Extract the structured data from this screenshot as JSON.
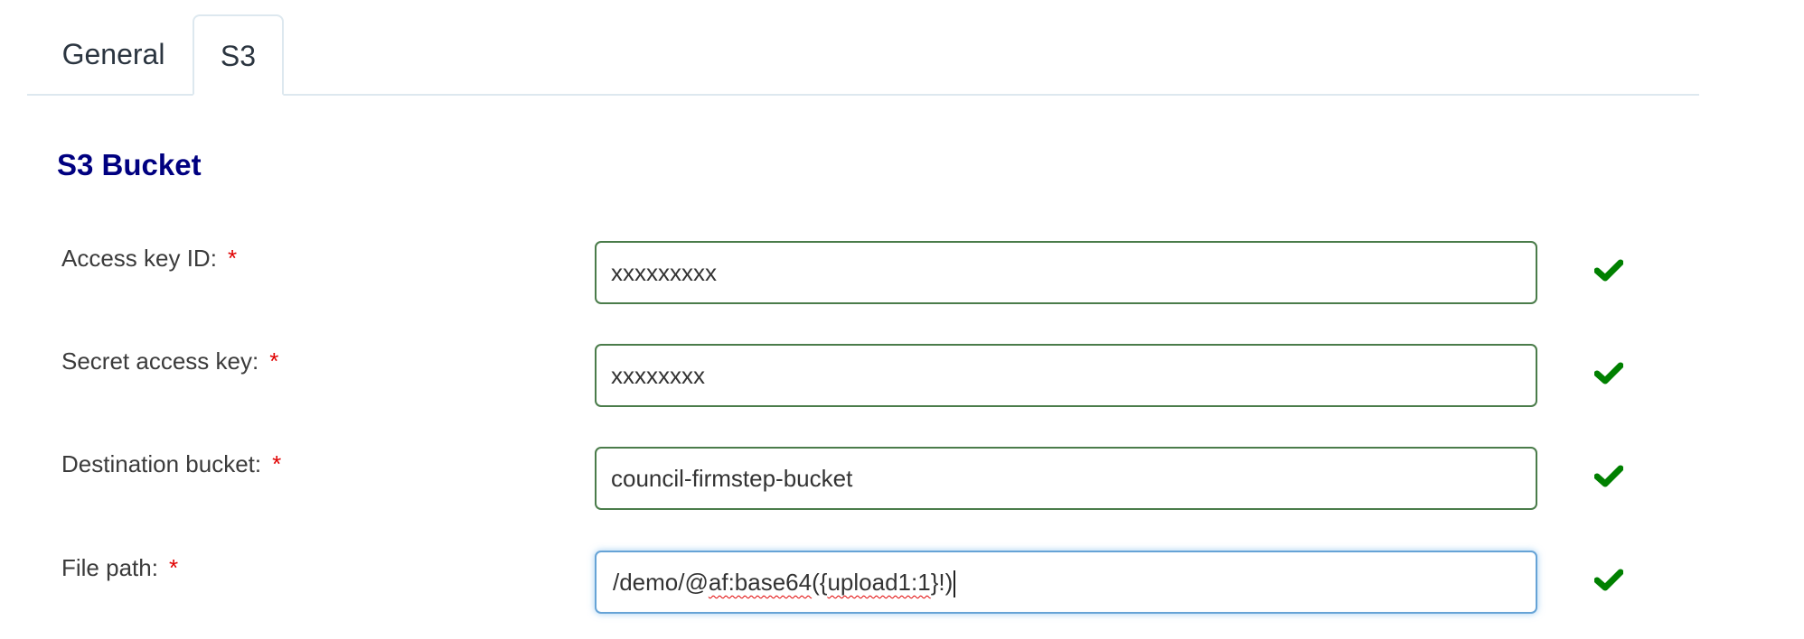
{
  "tabs": [
    {
      "label": "General",
      "active": false
    },
    {
      "label": "S3",
      "active": true
    }
  ],
  "section": {
    "title": "S3 Bucket"
  },
  "colors": {
    "heading": "#000080",
    "required": "#e00000",
    "valid_border": "#4a7c4a",
    "focus_border": "#66a3d6",
    "valid_icon": "#008000"
  },
  "fields": [
    {
      "label": "Access key ID:",
      "required_mark": "*",
      "value": "xxxxxxxxx",
      "status_icon": "check-icon",
      "focused": false
    },
    {
      "label": "Secret access key:",
      "required_mark": "*",
      "value": "xxxxxxxx",
      "status_icon": "check-icon",
      "focused": false
    },
    {
      "label": "Destination bucket:",
      "required_mark": "*",
      "value": "council-firmstep-bucket",
      "status_icon": "check-icon",
      "focused": false
    },
    {
      "label": "File path:",
      "required_mark": "*",
      "value": "/demo/@af:base64({upload1:1}!)",
      "status_icon": "check-icon",
      "focused": true,
      "value_parts": [
        "/demo/@",
        "af:base64",
        "({",
        "upload1:1",
        "}!)"
      ]
    }
  ]
}
